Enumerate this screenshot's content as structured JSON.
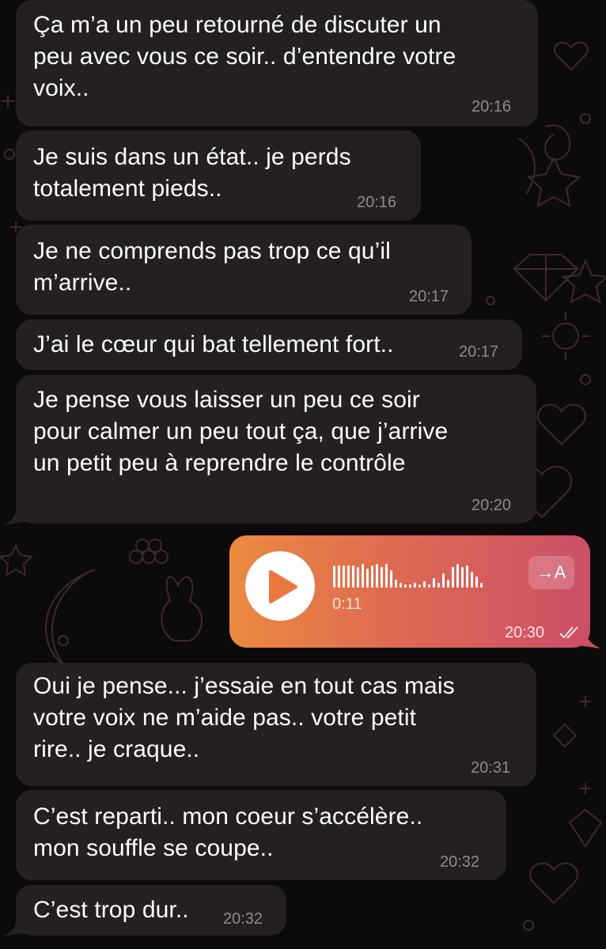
{
  "messages": [
    {
      "text": "Ça m’a un peu retourné de discuter un\npeu avec vous ce soir.. d’entendre votre\nvoix..",
      "time": "20:16"
    },
    {
      "text": "Je suis dans un état.. je perds\ntotalement pieds..",
      "time": "20:16"
    },
    {
      "text": "Je ne comprends pas trop ce qu’il\nm’arrive..",
      "time": "20:17"
    },
    {
      "text": "J’ai le cœur qui bat tellement fort..",
      "time": "20:17"
    },
    {
      "text": "Je pense vous laisser un peu ce soir\npour calmer un peu tout ça, que j’arrive\nun petit peu à reprendre le contrôle",
      "time": "20:20"
    },
    {
      "text": "Oui je pense... j’essaie en tout cas mais\nvotre voix ne m’aide pas.. votre petit\nrire.. je craque..",
      "time": "20:31"
    },
    {
      "text": "C’est reparti.. mon coeur s’accélère..\nmon souffle se coupe..",
      "time": "20:32"
    },
    {
      "text": "C’est trop dur..",
      "time": "20:32"
    }
  ],
  "voice_message": {
    "duration": "0:11",
    "time": "20:30",
    "transcribe_label": "→A",
    "play_icon": "play-icon",
    "read_status_icon": "double-check-icon",
    "gradient_colors": [
      "#ec8a3f",
      "#de6a52",
      "#cc4f68"
    ]
  },
  "colors": {
    "background": "#0d0a0b",
    "incoming_bubble": "#262122",
    "timestamp": "#8e8a8b"
  }
}
